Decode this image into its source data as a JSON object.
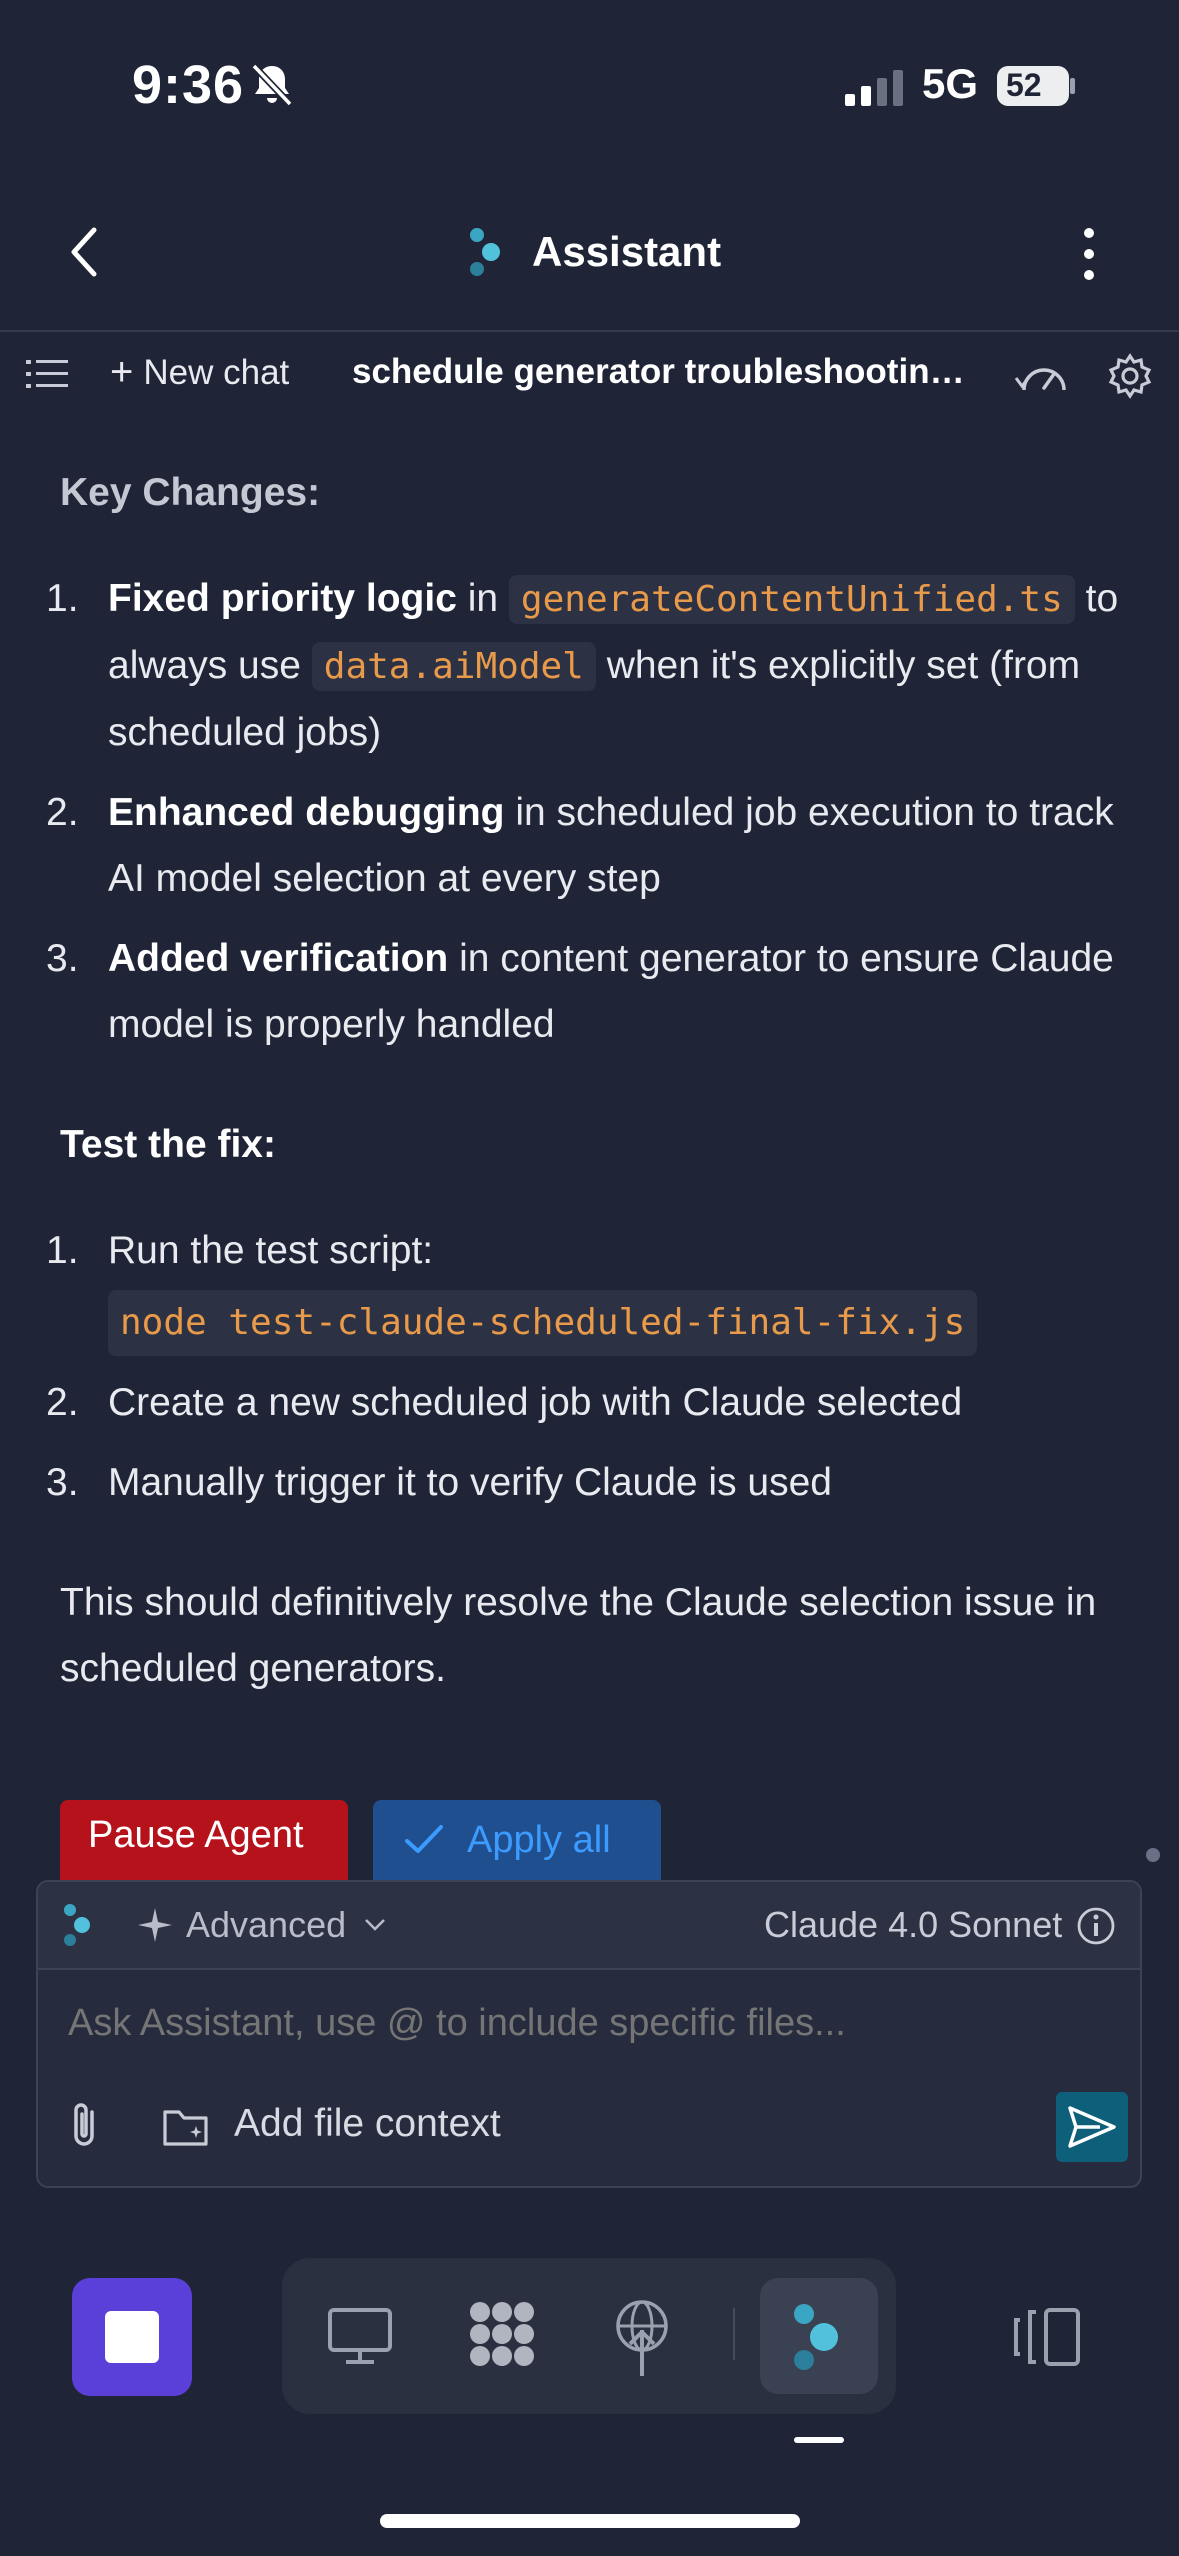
{
  "status": {
    "time": "9:36",
    "network": "5G",
    "battery": "52"
  },
  "header": {
    "title": "Assistant"
  },
  "toolbar": {
    "new_chat": "New chat",
    "chat_title": "schedule generator troubleshooting ..."
  },
  "message": {
    "key_changes_heading": "Key Changes:",
    "changes": [
      {
        "num": "1.",
        "bold": "Fixed priority logic",
        "text_a": " in ",
        "code_a": "generateContentUnified.ts",
        "text_b": " to always use ",
        "code_b": "data.aiModel",
        "text_c": " when it's explicitly set (from scheduled jobs)"
      },
      {
        "num": "2.",
        "bold": "Enhanced debugging",
        "text": " in scheduled job execution to track AI model selection at every step"
      },
      {
        "num": "3.",
        "bold": "Added verification",
        "text": " in content generator to ensure Claude model is properly handled"
      }
    ],
    "test_heading": "Test the fix:",
    "steps": [
      {
        "num": "1.",
        "text": "Run the test script:",
        "code": "node test-claude-scheduled-final-fix.js"
      },
      {
        "num": "2.",
        "text": "Create a new scheduled job with Claude selected"
      },
      {
        "num": "3.",
        "text": "Manually trigger it to verify Claude is used"
      }
    ],
    "conclusion": "This should definitively resolve the Claude selection issue in scheduled generators."
  },
  "actions": {
    "pause": "Pause Agent",
    "apply": "Apply all"
  },
  "composer": {
    "mode": "Advanced",
    "model": "Claude 4.0 Sonnet",
    "placeholder": "Ask Assistant, use @ to include specific files...",
    "add_context": "Add file context"
  },
  "icons": {
    "back": "chevron-left-icon",
    "kebab": "more-vertical-icon",
    "list": "list-icon",
    "gauge": "gauge-icon",
    "gear": "gear-icon",
    "send": "send-icon",
    "clip": "paperclip-icon",
    "folder": "folder-add-icon"
  },
  "colors": {
    "background": "#1f2536",
    "code_text": "#e89a4a",
    "pause_button": "#b5121b",
    "apply_text": "#3c9bff",
    "send_button": "#0e5f7a",
    "stop_button": "#5b3fd9"
  }
}
